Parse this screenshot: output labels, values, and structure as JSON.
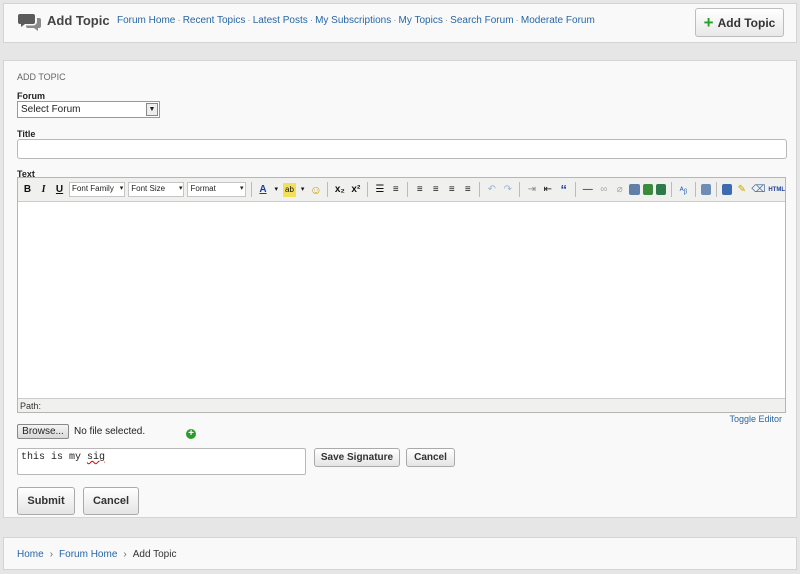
{
  "header": {
    "title": "Add Topic",
    "nav": [
      "Forum Home",
      "Recent Topics",
      "Latest Posts",
      "My Subscriptions",
      "My Topics",
      "Search Forum",
      "Moderate Forum"
    ],
    "nav_separator": "·",
    "add_topic_button": "Add Topic"
  },
  "form": {
    "section_label": "ADD TOPIC",
    "forum_label": "Forum",
    "forum_select_value": "Select Forum",
    "title_label": "Title",
    "title_value": "",
    "text_label": "Text",
    "toolbar": {
      "bold": "B",
      "italic": "I",
      "underline": "U",
      "font_family": "Font Family",
      "font_size": "Font Size",
      "format": "Format",
      "subscript": "x₂",
      "superscript": "x²",
      "quote": "“",
      "html": "HTML"
    },
    "path_label": "Path:",
    "toggle_editor": "Toggle Editor",
    "browse_button": "Browse...",
    "no_file_text": "No file selected.",
    "signature_value_prefix": "this is my ",
    "signature_value_misspelled": "sig",
    "save_signature_button": "Save Signature",
    "cancel_signature_button": "Cancel",
    "submit_button": "Submit",
    "cancel_button": "Cancel"
  },
  "breadcrumb": {
    "items": [
      "Home",
      "Forum Home",
      "Add Topic"
    ],
    "separator": "›"
  },
  "colors": {
    "link": "#2866a6",
    "add_green": "#2a9c2a",
    "background": "#e6e6e6",
    "panel": "#f9f9f9"
  }
}
